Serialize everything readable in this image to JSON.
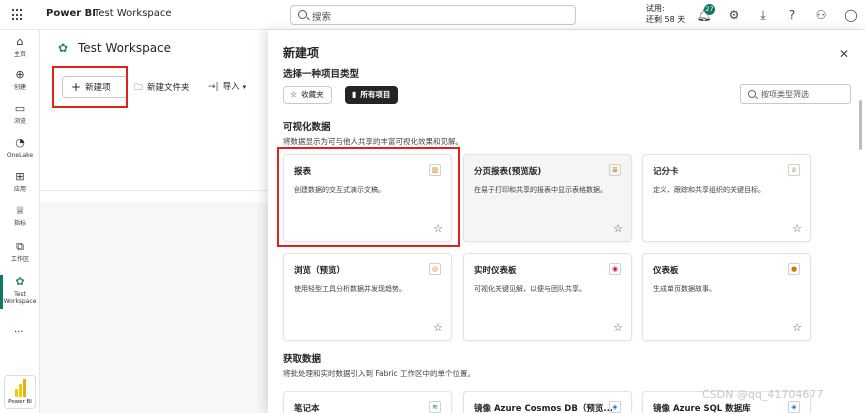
{
  "topbar": {
    "brand": "Power BI",
    "workspace": "Test Workspace",
    "search_placeholder": "搜索",
    "trial_line1": "试用:",
    "trial_line2": "还剩 58 天",
    "notification_count": "27"
  },
  "leftnav": {
    "items": [
      {
        "label": "主页",
        "icon": "home-icon"
      },
      {
        "label": "创建",
        "icon": "plus-circle-icon"
      },
      {
        "label": "浏览",
        "icon": "folder-icon"
      },
      {
        "label": "OneLake",
        "icon": "onelake-icon"
      },
      {
        "label": "应用",
        "icon": "apps-icon"
      },
      {
        "label": "指标",
        "icon": "trophy-icon"
      },
      {
        "label": "工作区",
        "icon": "workspaces-icon"
      },
      {
        "label": "Test Workspace",
        "icon": "workspace-icon"
      }
    ],
    "more": "...",
    "bottom_label": "Power BI"
  },
  "workspace": {
    "title": "Test Workspace",
    "new_item": "新建项",
    "new_folder": "新建文件夹",
    "import": "导入"
  },
  "dialog": {
    "title": "新建项",
    "subtitle": "选择一种项目类型",
    "chip_favorites": "收藏夹",
    "chip_all": "所有项目",
    "filter_placeholder": "按项类型筛选",
    "sections": [
      {
        "title": "可视化数据",
        "description": "将数据显示为可与他人共享的丰富可视化效果和见解。",
        "cards": [
          {
            "title": "报表",
            "description": "创建数据的交互式演示文稿。"
          },
          {
            "title": "分页报表(预览版)",
            "description": "在易于打印和共享的报表中显示表格数据。"
          },
          {
            "title": "记分卡",
            "description": "定义、跟踪和共享组织的关键目标。"
          },
          {
            "title": "浏览（预览）",
            "description": "使用轻型工具分析数据并发现趋势。"
          },
          {
            "title": "实时仪表板",
            "description": "可视化关键见解，以便与团队共享。"
          },
          {
            "title": "仪表板",
            "description": "生成单页数据故事。"
          }
        ]
      },
      {
        "title": "获取数据",
        "description": "将批处理和实时数据引入到 Fabric 工作区中的单个位置。",
        "cards": [
          {
            "title": "笔记本",
            "description": ""
          },
          {
            "title": "镜像 Azure Cosmos DB（预览...",
            "description": ""
          },
          {
            "title": "镜像 Azure SQL 数据库",
            "description": ""
          }
        ]
      }
    ]
  },
  "watermark": "CSDN @qq_41704677",
  "colors": {
    "accent": "#117865",
    "highlight": "#e0201c",
    "powerbi_yellow": "#f2c811"
  }
}
